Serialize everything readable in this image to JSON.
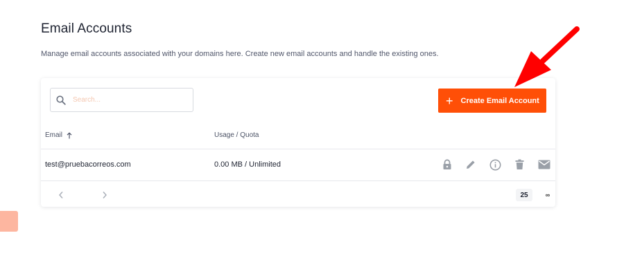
{
  "header": {
    "title": "Email Accounts",
    "description": "Manage email accounts associated with your domains here. Create new email accounts and handle the existing ones."
  },
  "search": {
    "placeholder": "Search..."
  },
  "toolbar": {
    "create_label": "Create Email Account",
    "create_icon": "plus-icon"
  },
  "table": {
    "columns": [
      {
        "label": "Email",
        "sort": "ascending"
      },
      {
        "label": "Usage / Quota"
      }
    ],
    "rows": [
      {
        "email": "test@pruebacorreos.com",
        "usage": "0.00 MB / Unlimited",
        "actions": [
          "lock-icon",
          "edit-icon",
          "info-icon",
          "delete-icon",
          "mail-icon"
        ]
      }
    ]
  },
  "pagination": {
    "per_page": "25",
    "show_all": "∞"
  },
  "colors": {
    "accent": "#ff4f07",
    "annotation_arrow": "#ff0000"
  }
}
